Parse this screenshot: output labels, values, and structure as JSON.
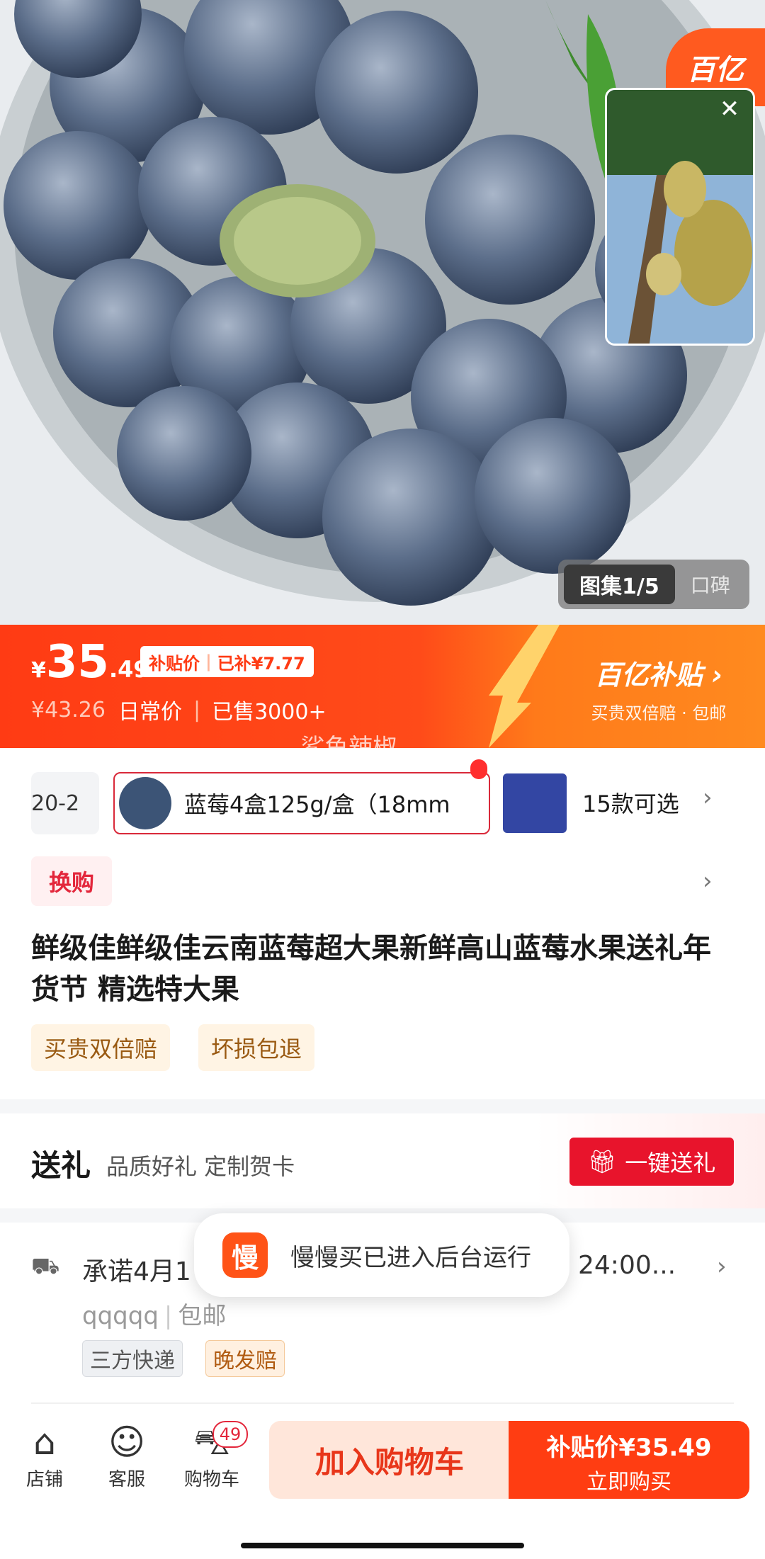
{
  "gallery": {
    "active": "图集1/5",
    "other": "口碑"
  },
  "brand": {
    "corner": "百亿",
    "right_title": "百亿补贴",
    "right_sub": "买贵双倍赔 · 包邮"
  },
  "price": {
    "currency": "¥",
    "integer": "35",
    "decimal": ".49",
    "subsidy_label": "补贴价",
    "subsidy_amount": "已补¥7.77",
    "original": "¥43.26",
    "original_label": "日常价",
    "sold": "已售3000+"
  },
  "watermark": "-鲨鱼辣椒",
  "sku": {
    "left_partial": "20-2",
    "selected": "蓝莓4盒125g/盒（18mm",
    "more": "15款可选"
  },
  "swap_label": "换购",
  "product_title": "鲜级佳鲜级佳云南蓝莓超大果新鲜高山蓝莓水果送礼年货节 精选特大果",
  "badges": [
    "买贵双倍赔",
    "坏损包退"
  ],
  "gift": {
    "title": "送礼",
    "subtitle": "品质好礼  定制贺卡",
    "button": "一键送礼"
  },
  "shipping": {
    "promise_start": "承诺4月1",
    "promise_end": "24:00...",
    "sub_name": "qqqqq",
    "sub_free": "包邮",
    "tags": [
      "三方快递",
      "晚发赔"
    ]
  },
  "toast": {
    "icon_char": "慢",
    "text": "慢慢买已进入后台运行"
  },
  "bottom": {
    "store": "店铺",
    "service": "客服",
    "cart": "购物车",
    "cart_count": "49",
    "add_to_cart": "加入购物车",
    "buy_line1": "补贴价¥35.49",
    "buy_line2": "立即购买"
  },
  "colors": {
    "accent": "#ff3b14",
    "red": "#e8142c",
    "badge_bg": "#fff4e4"
  }
}
